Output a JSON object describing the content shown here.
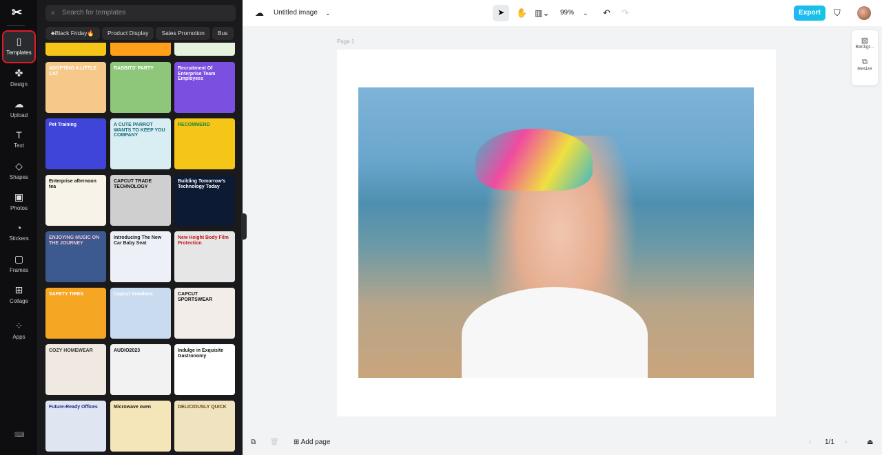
{
  "rail": {
    "items": [
      {
        "label": "Templates",
        "icon": "templates-icon",
        "glyph": "▯"
      },
      {
        "label": "Design",
        "icon": "design-icon",
        "glyph": "✤"
      },
      {
        "label": "Upload",
        "icon": "upload-icon",
        "glyph": "☁"
      },
      {
        "label": "Text",
        "icon": "text-icon",
        "glyph": "T"
      },
      {
        "label": "Shapes",
        "icon": "shapes-icon",
        "glyph": "◇"
      },
      {
        "label": "Photos",
        "icon": "photos-icon",
        "glyph": "▣"
      },
      {
        "label": "Stickers",
        "icon": "stickers-icon",
        "glyph": "◔"
      },
      {
        "label": "Frames",
        "icon": "frames-icon",
        "glyph": "▢"
      },
      {
        "label": "Collage",
        "icon": "collage-icon",
        "glyph": "⊞"
      },
      {
        "label": "Apps",
        "icon": "apps-icon",
        "glyph": "⁘"
      }
    ],
    "active": "Templates"
  },
  "panel": {
    "search_placeholder": "Search for templates",
    "chips": [
      "♣Black Friday🔥",
      "Product Display",
      "Sales Promotion",
      "Bus"
    ],
    "cards": [
      {
        "text": "ADOPTING A LITTLE CAT",
        "bg": "#f6c98a",
        "fg": "#fff"
      },
      {
        "text": "RABBITS' PARTY",
        "bg": "#8fc77a",
        "fg": "#fff"
      },
      {
        "text": "Recruitment Of Enterprise Team Employees",
        "bg": "#7b4fe0",
        "fg": "#fff"
      },
      {
        "text": "Pet Training",
        "bg": "#3f45d8",
        "fg": "#fff"
      },
      {
        "text": "A CUTE PARROT WANTS TO KEEP YOU COMPANY",
        "bg": "#d9eef2",
        "fg": "#1a6b7a"
      },
      {
        "text": "RECOMMEND",
        "bg": "#f5c518",
        "fg": "#1a8a3a"
      },
      {
        "text": "Enterprise afternoon tea",
        "bg": "#f7f3e8",
        "fg": "#111"
      },
      {
        "text": "CAPCUT TRADE TECHNOLOGY",
        "bg": "#cfcfcf",
        "fg": "#111"
      },
      {
        "text": "Building Tomorrow's Technology Today",
        "bg": "#0d1a33",
        "fg": "#fff"
      },
      {
        "text": "ENJOYING MUSIC ON THE JOURNEY",
        "bg": "#3c5a90",
        "fg": "#f0c0d0"
      },
      {
        "text": "Introducing The New Car Baby Seat",
        "bg": "#eef0f8",
        "fg": "#222"
      },
      {
        "text": "New Height Body Film Protection",
        "bg": "#e6e6e6",
        "fg": "#c01818"
      },
      {
        "text": "SAFETY TIRES",
        "bg": "#f5a623",
        "fg": "#fff"
      },
      {
        "text": "Capcut Sneakers",
        "bg": "#c9dcef",
        "fg": "#fff"
      },
      {
        "text": "CAPCUT SPORTSWEAR",
        "bg": "#f2ede8",
        "fg": "#111"
      },
      {
        "text": "COZY HOMEWEAR",
        "bg": "#efe9e2",
        "fg": "#333"
      },
      {
        "text": "AUDIO2023",
        "bg": "#f2f2f2",
        "fg": "#111"
      },
      {
        "text": "Indulge in Exquisite Gastronomy",
        "bg": "#ffffff",
        "fg": "#111"
      },
      {
        "text": "Future-Ready Offices",
        "bg": "#dfe6f2",
        "fg": "#1a2a8a"
      },
      {
        "text": "Microwave oven",
        "bg": "#f4e6b8",
        "fg": "#222"
      },
      {
        "text": "DELICIOUSLY QUICK",
        "bg": "#f0e4c0",
        "fg": "#6a4a10"
      }
    ]
  },
  "topbar": {
    "title": "Untitled image",
    "zoom": "99%",
    "export_label": "Export"
  },
  "canvas": {
    "page_label": "Page 1"
  },
  "sidetools": {
    "background": "Backgr...",
    "resize": "Resize"
  },
  "bottombar": {
    "add_page": "Add page",
    "page_counter": "1/1"
  }
}
